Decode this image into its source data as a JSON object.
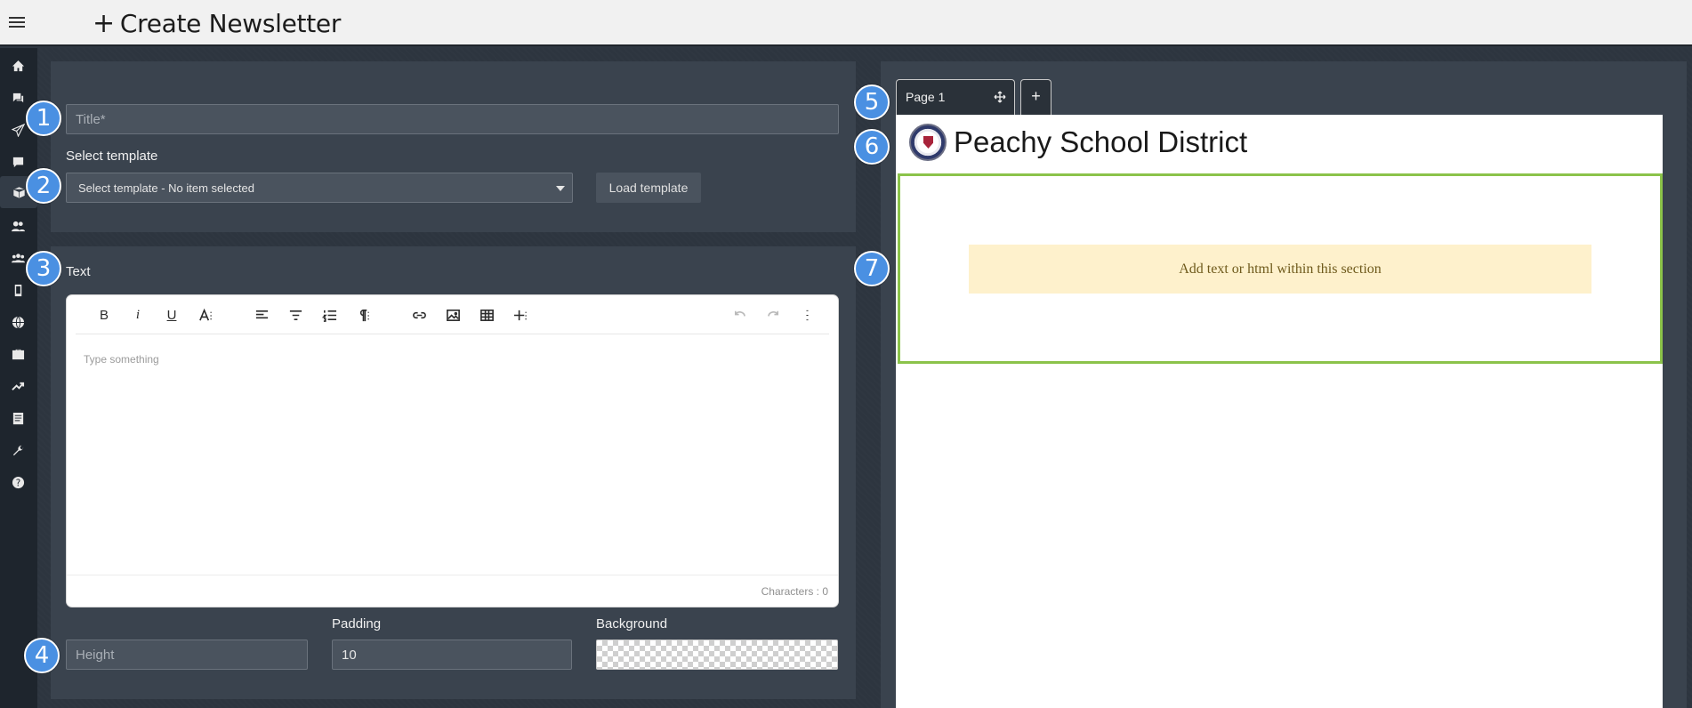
{
  "header": {
    "title": "Create Newsletter",
    "menu_icon": "hamburger-icon",
    "title_icon": "plus-icon"
  },
  "sidebar": {
    "items": [
      {
        "icon": "home-icon"
      },
      {
        "icon": "chat-bubbles-icon"
      },
      {
        "icon": "send-icon"
      },
      {
        "icon": "comment-icon"
      },
      {
        "icon": "box-icon",
        "active": true
      },
      {
        "icon": "users-icon"
      },
      {
        "icon": "groups-icon"
      },
      {
        "icon": "mobile-icon"
      },
      {
        "icon": "globe-icon"
      },
      {
        "icon": "briefcase-icon"
      },
      {
        "icon": "trending-icon"
      },
      {
        "icon": "document-icon"
      },
      {
        "icon": "wrench-icon"
      },
      {
        "icon": "help-icon"
      }
    ]
  },
  "form": {
    "title_placeholder": "Title*",
    "select_template_label": "Select template",
    "select_template_value": "Select template - No item selected",
    "load_template_label": "Load template",
    "text_label": "Text",
    "editor_placeholder": "Type something",
    "characters_label": "Characters : 0",
    "padding_label": "Padding",
    "padding_value": "10",
    "background_label": "Background",
    "height_placeholder": "Height"
  },
  "editor_toolbar": [
    "bold",
    "italic",
    "underline",
    "font-size",
    "align-left",
    "align-center",
    "ordered-list",
    "paragraph",
    "link",
    "image",
    "table",
    "insert-more",
    "undo",
    "redo",
    "more-options"
  ],
  "preview": {
    "page_tab_label": "Page 1",
    "add_page_label": "+",
    "district_name": "Peachy School District",
    "section_hint": "Add text or html within this section"
  },
  "steps": [
    "1",
    "2",
    "3",
    "4",
    "5",
    "6",
    "7"
  ],
  "colors": {
    "accent_green": "#8bc34a",
    "badge_blue": "#4a90e2",
    "hint_bg": "#fef1cc"
  }
}
